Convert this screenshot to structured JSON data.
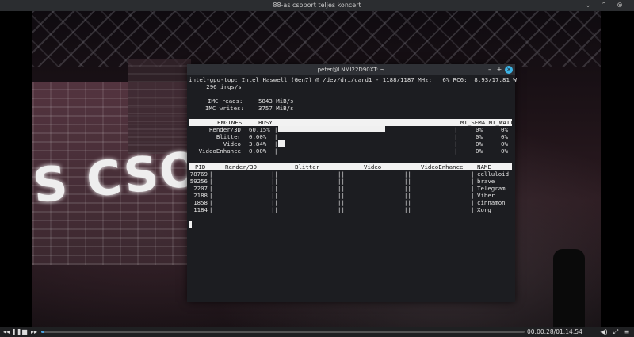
{
  "player": {
    "title": "88-as csoport  teljes koncert",
    "time_display": "00:00:28/01:14:54",
    "progress_fraction": 0.006,
    "video_overlay_text": "S CSOPO"
  },
  "terminal": {
    "title": "peter@LNMI22D90XT: ~",
    "line1": "intel-gpu-top: Intel Haswell (Gen7) @ /dev/dri/card1 - 1188/1187 MHz;   6% RC6;  8.93/17.81 W",
    "line2": "     296 irqs/s",
    "imc_reads_label": "IMC reads:",
    "imc_reads_value": "5843 MiB/s",
    "imc_writes_label": "IMC writes:",
    "imc_writes_value": "3757 MiB/s",
    "engines_header": {
      "engines": "ENGINES",
      "busy": "BUSY",
      "sema_wait": "MI_SEMA MI_WAIT"
    },
    "engines": [
      {
        "name": "Render/3D",
        "busy": "60.15%",
        "busy_fraction": 0.6015,
        "sema": "0%",
        "wait": "0%"
      },
      {
        "name": "Blitter",
        "busy": "0.00%",
        "busy_fraction": 0.0,
        "sema": "0%",
        "wait": "0%"
      },
      {
        "name": "Video",
        "busy": "3.84%",
        "busy_fraction": 0.0384,
        "sema": "0%",
        "wait": "0%"
      },
      {
        "name": "VideoEnhance",
        "busy": "0.00%",
        "busy_fraction": 0.0,
        "sema": "0%",
        "wait": "0%"
      }
    ],
    "proc_header": {
      "pid": "PID",
      "render": "Render/3D",
      "blitter": "Blitter",
      "video": "Video",
      "enhance": "VideoEnhance",
      "name": "NAME"
    },
    "processes": [
      {
        "pid": "78769",
        "name": "celluloid"
      },
      {
        "pid": "59256",
        "name": "brave"
      },
      {
        "pid": "2207",
        "name": "Telegram"
      },
      {
        "pid": "2188",
        "name": "Viber"
      },
      {
        "pid": "1858",
        "name": "cinnamon"
      },
      {
        "pid": "1184",
        "name": "Xorg"
      }
    ]
  },
  "icons": {
    "rewind": "rewind-icon",
    "pause": "pause-icon",
    "stop": "stop-icon",
    "forward": "fast-forward-icon",
    "volume": "volume-icon",
    "fullscreen": "fullscreen-icon",
    "menu": "menu-icon"
  }
}
